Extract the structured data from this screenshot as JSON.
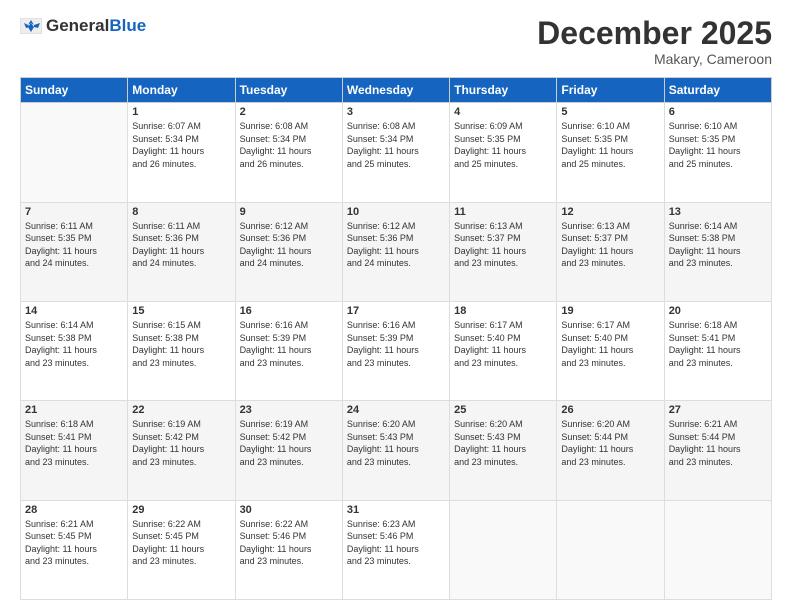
{
  "header": {
    "logo_general": "General",
    "logo_blue": "Blue",
    "month_title": "December 2025",
    "location": "Makary, Cameroon"
  },
  "days_of_week": [
    "Sunday",
    "Monday",
    "Tuesday",
    "Wednesday",
    "Thursday",
    "Friday",
    "Saturday"
  ],
  "weeks": [
    [
      {
        "day": "",
        "info": ""
      },
      {
        "day": "1",
        "info": "Sunrise: 6:07 AM\nSunset: 5:34 PM\nDaylight: 11 hours\nand 26 minutes."
      },
      {
        "day": "2",
        "info": "Sunrise: 6:08 AM\nSunset: 5:34 PM\nDaylight: 11 hours\nand 26 minutes."
      },
      {
        "day": "3",
        "info": "Sunrise: 6:08 AM\nSunset: 5:34 PM\nDaylight: 11 hours\nand 25 minutes."
      },
      {
        "day": "4",
        "info": "Sunrise: 6:09 AM\nSunset: 5:35 PM\nDaylight: 11 hours\nand 25 minutes."
      },
      {
        "day": "5",
        "info": "Sunrise: 6:10 AM\nSunset: 5:35 PM\nDaylight: 11 hours\nand 25 minutes."
      },
      {
        "day": "6",
        "info": "Sunrise: 6:10 AM\nSunset: 5:35 PM\nDaylight: 11 hours\nand 25 minutes."
      }
    ],
    [
      {
        "day": "7",
        "info": "Sunrise: 6:11 AM\nSunset: 5:35 PM\nDaylight: 11 hours\nand 24 minutes."
      },
      {
        "day": "8",
        "info": "Sunrise: 6:11 AM\nSunset: 5:36 PM\nDaylight: 11 hours\nand 24 minutes."
      },
      {
        "day": "9",
        "info": "Sunrise: 6:12 AM\nSunset: 5:36 PM\nDaylight: 11 hours\nand 24 minutes."
      },
      {
        "day": "10",
        "info": "Sunrise: 6:12 AM\nSunset: 5:36 PM\nDaylight: 11 hours\nand 24 minutes."
      },
      {
        "day": "11",
        "info": "Sunrise: 6:13 AM\nSunset: 5:37 PM\nDaylight: 11 hours\nand 23 minutes."
      },
      {
        "day": "12",
        "info": "Sunrise: 6:13 AM\nSunset: 5:37 PM\nDaylight: 11 hours\nand 23 minutes."
      },
      {
        "day": "13",
        "info": "Sunrise: 6:14 AM\nSunset: 5:38 PM\nDaylight: 11 hours\nand 23 minutes."
      }
    ],
    [
      {
        "day": "14",
        "info": "Sunrise: 6:14 AM\nSunset: 5:38 PM\nDaylight: 11 hours\nand 23 minutes."
      },
      {
        "day": "15",
        "info": "Sunrise: 6:15 AM\nSunset: 5:38 PM\nDaylight: 11 hours\nand 23 minutes."
      },
      {
        "day": "16",
        "info": "Sunrise: 6:16 AM\nSunset: 5:39 PM\nDaylight: 11 hours\nand 23 minutes."
      },
      {
        "day": "17",
        "info": "Sunrise: 6:16 AM\nSunset: 5:39 PM\nDaylight: 11 hours\nand 23 minutes."
      },
      {
        "day": "18",
        "info": "Sunrise: 6:17 AM\nSunset: 5:40 PM\nDaylight: 11 hours\nand 23 minutes."
      },
      {
        "day": "19",
        "info": "Sunrise: 6:17 AM\nSunset: 5:40 PM\nDaylight: 11 hours\nand 23 minutes."
      },
      {
        "day": "20",
        "info": "Sunrise: 6:18 AM\nSunset: 5:41 PM\nDaylight: 11 hours\nand 23 minutes."
      }
    ],
    [
      {
        "day": "21",
        "info": "Sunrise: 6:18 AM\nSunset: 5:41 PM\nDaylight: 11 hours\nand 23 minutes."
      },
      {
        "day": "22",
        "info": "Sunrise: 6:19 AM\nSunset: 5:42 PM\nDaylight: 11 hours\nand 23 minutes."
      },
      {
        "day": "23",
        "info": "Sunrise: 6:19 AM\nSunset: 5:42 PM\nDaylight: 11 hours\nand 23 minutes."
      },
      {
        "day": "24",
        "info": "Sunrise: 6:20 AM\nSunset: 5:43 PM\nDaylight: 11 hours\nand 23 minutes."
      },
      {
        "day": "25",
        "info": "Sunrise: 6:20 AM\nSunset: 5:43 PM\nDaylight: 11 hours\nand 23 minutes."
      },
      {
        "day": "26",
        "info": "Sunrise: 6:20 AM\nSunset: 5:44 PM\nDaylight: 11 hours\nand 23 minutes."
      },
      {
        "day": "27",
        "info": "Sunrise: 6:21 AM\nSunset: 5:44 PM\nDaylight: 11 hours\nand 23 minutes."
      }
    ],
    [
      {
        "day": "28",
        "info": "Sunrise: 6:21 AM\nSunset: 5:45 PM\nDaylight: 11 hours\nand 23 minutes."
      },
      {
        "day": "29",
        "info": "Sunrise: 6:22 AM\nSunset: 5:45 PM\nDaylight: 11 hours\nand 23 minutes."
      },
      {
        "day": "30",
        "info": "Sunrise: 6:22 AM\nSunset: 5:46 PM\nDaylight: 11 hours\nand 23 minutes."
      },
      {
        "day": "31",
        "info": "Sunrise: 6:23 AM\nSunset: 5:46 PM\nDaylight: 11 hours\nand 23 minutes."
      },
      {
        "day": "",
        "info": ""
      },
      {
        "day": "",
        "info": ""
      },
      {
        "day": "",
        "info": ""
      }
    ]
  ]
}
